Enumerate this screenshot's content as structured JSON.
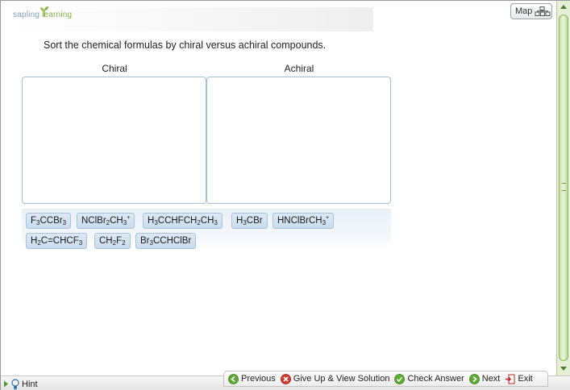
{
  "branding": {
    "logo_part1": "sapling",
    "logo_part2": "learning"
  },
  "map": {
    "label": "Map"
  },
  "question": {
    "prompt": "Sort the chemical formulas by chiral versus achiral compounds."
  },
  "bins": {
    "chiral_label": "Chiral",
    "achiral_label": "Achiral"
  },
  "tiles": [
    {
      "id": "f3ccbr3",
      "html": "F<sub>3</sub>CCBr<sub>3</sub>"
    },
    {
      "id": "nclbr2ch3",
      "html": "NClBr<sub>2</sub>CH<sub>3</sub><sup>+</sup>"
    },
    {
      "id": "h3cchfch2ch3",
      "html": "H<sub>3</sub>CCHFCH<sub>2</sub>CH<sub>3</sub>"
    },
    {
      "id": "h3cbr",
      "html": "H<sub>3</sub>CBr"
    },
    {
      "id": "hnclbrch3",
      "html": "HNClBrCH<sub>3</sub><sup>+</sup>"
    },
    {
      "id": "h2cchcf3",
      "html": "H<sub>2</sub>C=CHCF<sub>3</sub>"
    },
    {
      "id": "ch2f2",
      "html": "CH<sub>2</sub>F<sub>2</sub>"
    },
    {
      "id": "br3cchclbr",
      "html": "Br<sub>3</sub>CCHClBr"
    }
  ],
  "footer": {
    "hint": "Hint",
    "previous": "Previous",
    "give_up": "Give Up & View Solution",
    "check_answer": "Check Answer",
    "next": "Next",
    "exit": "Exit"
  },
  "colors": {
    "accent_green": "#4f9a2e",
    "danger_red": "#cc2a1f",
    "tile_bg": "#c9dcef"
  }
}
